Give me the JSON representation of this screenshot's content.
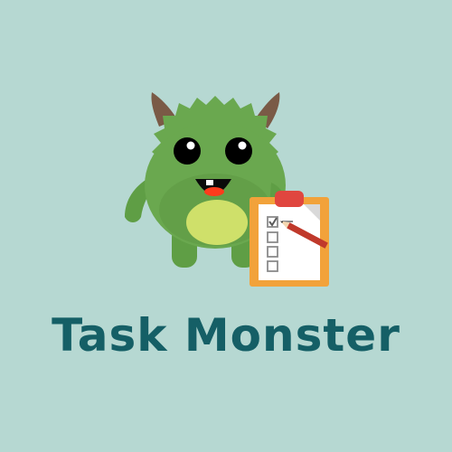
{
  "brand": {
    "name": "Task Monster"
  },
  "colors": {
    "background": "#b6d8d2",
    "monster_body": "#6aa84f",
    "monster_dark": "#4f8f3a",
    "belly": "#cfe06a",
    "horns": "#7a5a46",
    "clipboard_frame": "#f2a23a",
    "clip": "#e0463f",
    "text": "#155f66"
  },
  "icons": {
    "mascot": "monster-mascot-icon",
    "clipboard": "checklist-clipboard-icon",
    "pencil": "pencil-icon"
  },
  "checklist": {
    "items_checked": [
      true,
      false,
      false,
      false
    ]
  }
}
